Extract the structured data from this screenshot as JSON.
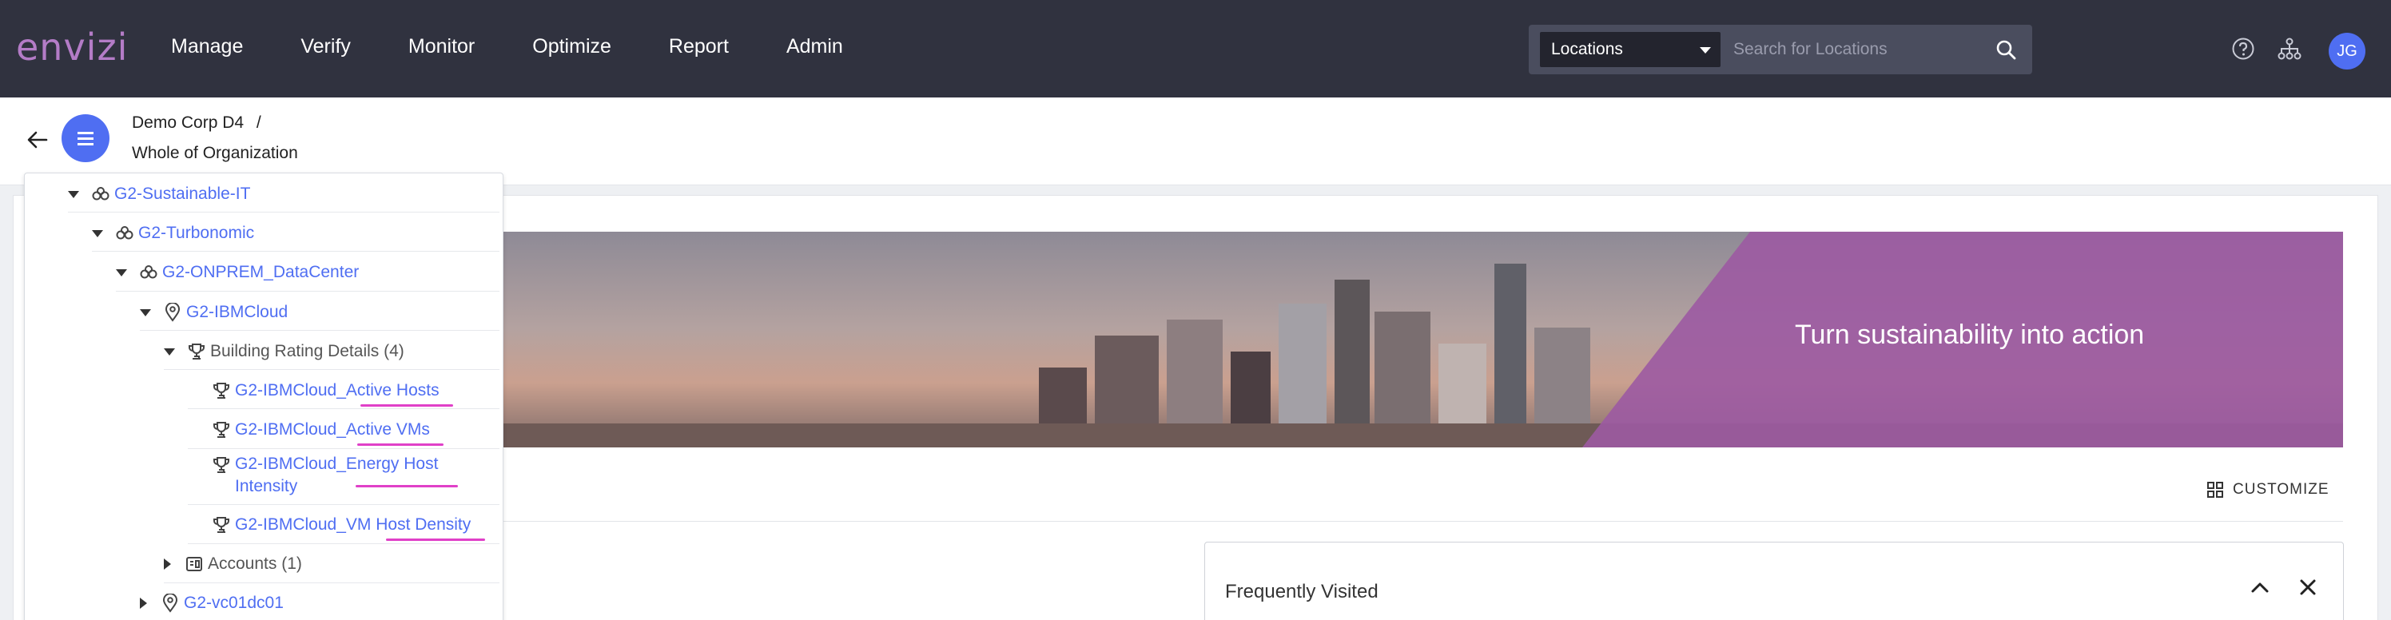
{
  "topbar": {
    "logo": "envizi",
    "nav": [
      "Manage",
      "Verify",
      "Monitor",
      "Optimize",
      "Report",
      "Admin"
    ],
    "location_select": "Locations",
    "search_placeholder": "Search for Locations",
    "avatar_initials": "JG"
  },
  "header": {
    "breadcrumb_org": "Demo Corp D4",
    "breadcrumb_sep": "/",
    "breadcrumb_current": "Whole of Organization"
  },
  "tree": {
    "items": [
      {
        "label": "G2-Sustainable-IT",
        "icon": "group-icon",
        "state": "expanded"
      },
      {
        "label": "G2-Turbonomic",
        "icon": "group-icon",
        "state": "expanded"
      },
      {
        "label": "G2-ONPREM_DataCenter",
        "icon": "group-icon",
        "state": "expanded"
      },
      {
        "label": "G2-IBMCloud",
        "icon": "location-pin-icon",
        "state": "expanded"
      },
      {
        "label": "Building Rating Details (4)",
        "icon": "trophy-icon",
        "state": "expanded"
      },
      {
        "label": "G2-IBMCloud_Active Hosts",
        "icon": "trophy-icon"
      },
      {
        "label": "G2-IBMCloud_Active VMs",
        "icon": "trophy-icon"
      },
      {
        "label_line1": "G2-IBMCloud_Energy Host",
        "label_line2": "Intensity",
        "icon": "trophy-icon"
      },
      {
        "label": "G2-IBMCloud_VM Host Density",
        "icon": "trophy-icon"
      },
      {
        "label": "Accounts (1)",
        "icon": "account-icon",
        "state": "collapsed"
      },
      {
        "label": "G2-vc01dc01",
        "icon": "location-pin-icon",
        "state": "collapsed"
      }
    ]
  },
  "banner": {
    "headline": "Turn sustainability into action"
  },
  "toolbar": {
    "customize": "CUSTOMIZE"
  },
  "frequently_visited": {
    "title": "Frequently Visited"
  },
  "colors": {
    "topbar": "#30323f",
    "accent": "#4f6ef2",
    "logo": "#b47cc7",
    "banner_purple": "#9c5aa2",
    "underline": "#e040c8"
  }
}
